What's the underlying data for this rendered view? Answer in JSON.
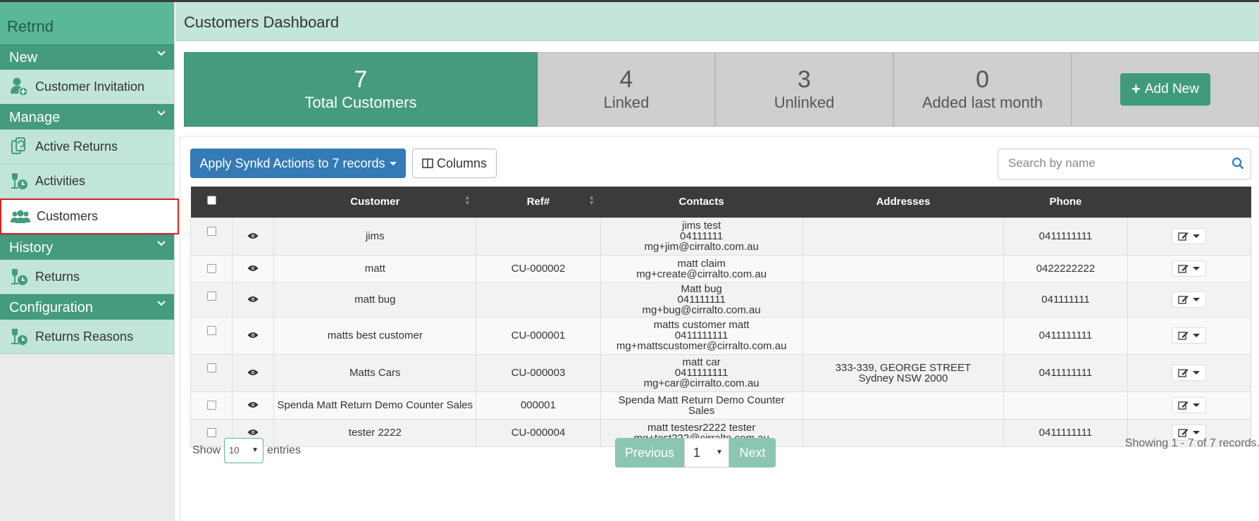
{
  "app": {
    "brand": "Retrnd",
    "page_title": "Customers Dashboard"
  },
  "sidebar": {
    "sections": [
      {
        "title": "New",
        "items": [
          {
            "label": "Customer Invitation",
            "icon": "add-user-icon"
          }
        ]
      },
      {
        "title": "Manage",
        "items": [
          {
            "label": "Active Returns",
            "icon": "active-returns-icon"
          },
          {
            "label": "Activities",
            "icon": "activities-icon"
          },
          {
            "label": "Customers",
            "icon": "customers-icon",
            "active": true
          }
        ]
      },
      {
        "title": "History",
        "items": [
          {
            "label": "Returns",
            "icon": "returns-icon"
          }
        ]
      },
      {
        "title": "Configuration",
        "items": [
          {
            "label": "Returns Reasons",
            "icon": "returns-reasons-icon"
          }
        ]
      }
    ]
  },
  "stats": {
    "total": {
      "value": "7",
      "label": "Total Customers"
    },
    "linked": {
      "value": "4",
      "label": "Linked"
    },
    "unlinked": {
      "value": "3",
      "label": "Unlinked"
    },
    "added": {
      "value": "0",
      "label": "Added last month"
    },
    "add_button": "Add New"
  },
  "toolbar": {
    "synk_label": "Apply Synkd Actions to 7 records",
    "columns_label": "Columns",
    "search_placeholder": "Search by name"
  },
  "table": {
    "headers": {
      "customer": "Customer",
      "ref": "Ref#",
      "contacts": "Contacts",
      "addresses": "Addresses",
      "phone": "Phone"
    },
    "rows": [
      {
        "customer": "jims",
        "ref": "",
        "contacts": [
          "jims test",
          "04111111",
          "mg+jim@cirralto.com.au"
        ],
        "addresses": [],
        "phone": "0411111111"
      },
      {
        "customer": "matt",
        "ref": "CU-000002",
        "contacts": [
          "matt claim",
          "mg+create@cirralto.com.au"
        ],
        "addresses": [],
        "phone": "0422222222"
      },
      {
        "customer": "matt bug",
        "ref": "",
        "contacts": [
          "Matt bug",
          "041111111",
          "mg+bug@cirralto.com.au"
        ],
        "addresses": [],
        "phone": "041111111"
      },
      {
        "customer": "matts best customer",
        "ref": "CU-000001",
        "contacts": [
          "matts customer matt",
          "0411111111",
          "mg+mattscustomer@cirralto.com.au"
        ],
        "addresses": [],
        "phone": "0411111111"
      },
      {
        "customer": "Matts Cars",
        "ref": "CU-000003",
        "contacts": [
          "matt car",
          "0411111111",
          "mg+car@cirralto.com.au"
        ],
        "addresses": [
          "333-339, GEORGE STREET",
          "Sydney NSW 2000"
        ],
        "phone": "0411111111"
      },
      {
        "customer": "Spenda Matt Return Demo Counter Sales",
        "ref": "000001",
        "contacts": [
          "Spenda Matt Return Demo Counter",
          "Sales"
        ],
        "addresses": [],
        "phone": ""
      },
      {
        "customer": "tester 2222",
        "ref": "CU-000004",
        "contacts": [
          "matt testesr2222 tester",
          "mg+test222@cirralto.com.au"
        ],
        "addresses": [],
        "phone": "0411111111"
      }
    ]
  },
  "footer": {
    "show_label": "Show",
    "entries_value": "10",
    "entries_label": "entries",
    "prev_label": "Previous",
    "page_value": "1",
    "next_label": "Next",
    "showing_text": "Showing 1 - 7 of 7 records."
  },
  "colors": {
    "brand_green": "#449b7d",
    "light_green": "#c1e5d9",
    "primary_blue": "#337ab7",
    "highlight_red": "#e02020"
  }
}
